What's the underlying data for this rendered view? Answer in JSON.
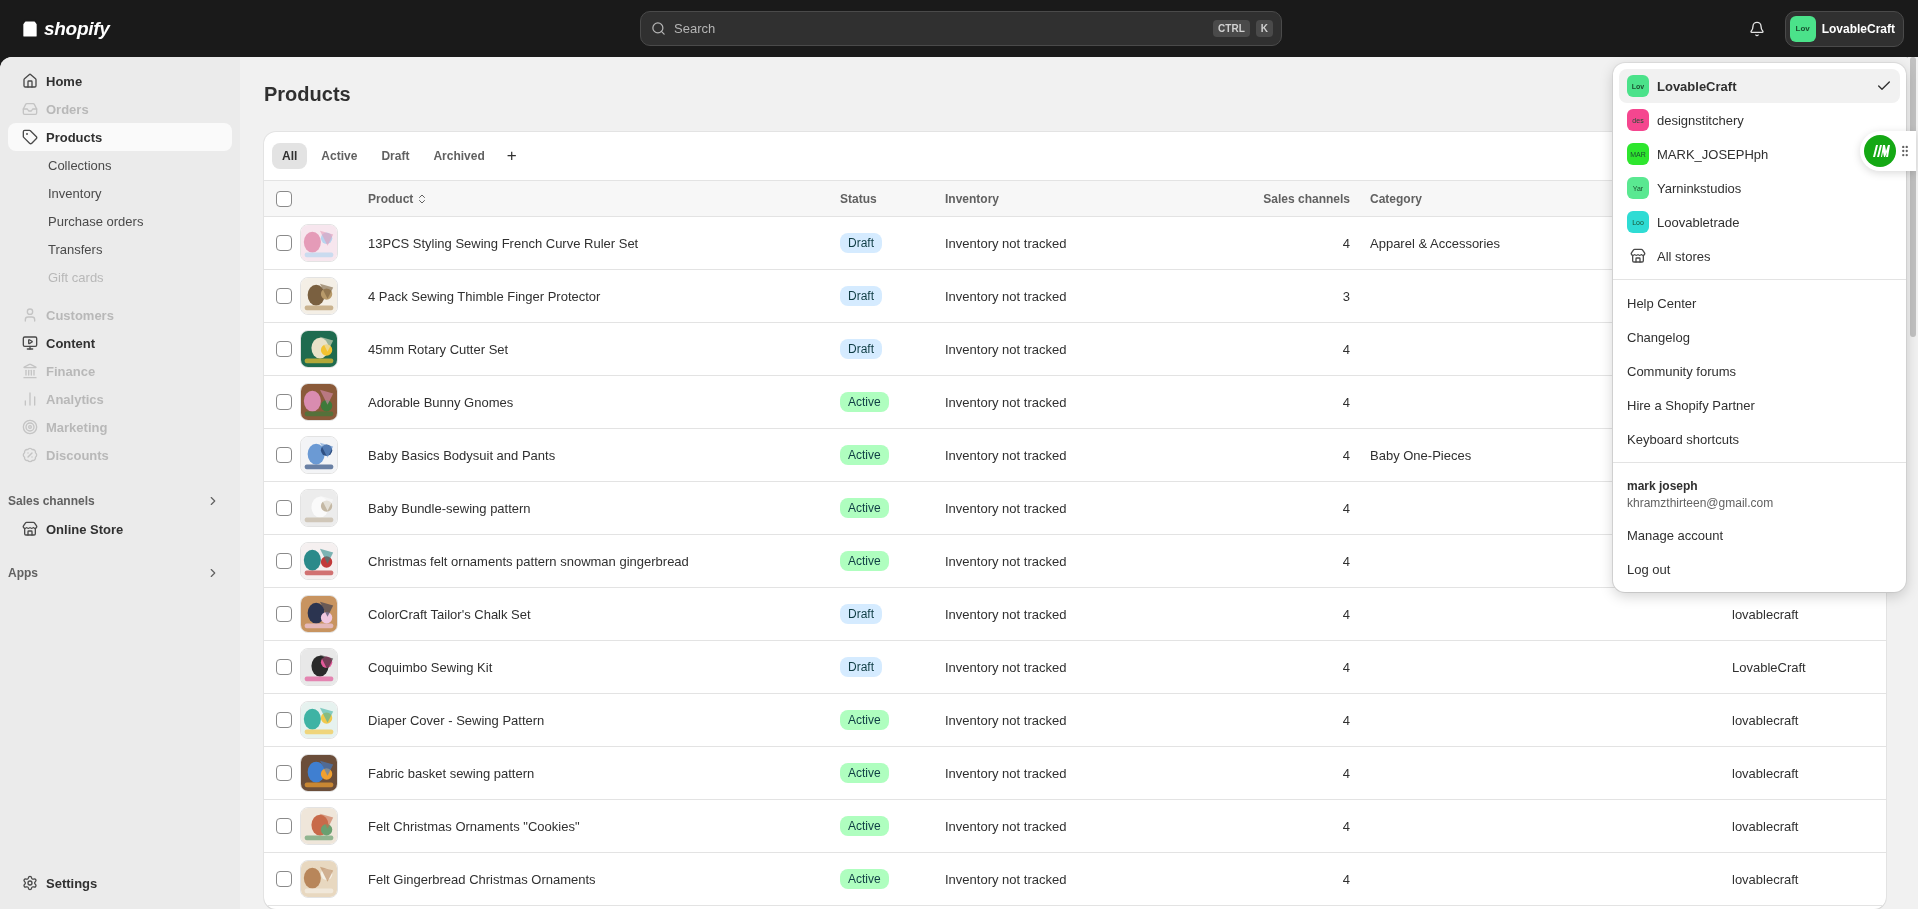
{
  "top_bar": {
    "logo": "shopify",
    "search": {
      "placeholder": "Search",
      "keys": [
        "CTRL",
        "K"
      ]
    },
    "store_button": {
      "initials": "Lov",
      "color": "#4be28a",
      "name": "LovableCraft"
    }
  },
  "sidebar": {
    "items": [
      {
        "label": "Home",
        "disabled": false,
        "selected": false
      },
      {
        "label": "Orders",
        "disabled": true,
        "selected": false
      },
      {
        "label": "Products",
        "disabled": false,
        "selected": true,
        "children": [
          {
            "label": "Collections",
            "disabled": false
          },
          {
            "label": "Inventory",
            "disabled": false
          },
          {
            "label": "Purchase orders",
            "disabled": false
          },
          {
            "label": "Transfers",
            "disabled": false
          },
          {
            "label": "Gift cards",
            "disabled": true
          }
        ]
      },
      {
        "label": "Customers",
        "disabled": true,
        "selected": false
      },
      {
        "label": "Content",
        "disabled": false,
        "selected": false
      },
      {
        "label": "Finance",
        "disabled": true,
        "selected": false
      },
      {
        "label": "Analytics",
        "disabled": true,
        "selected": false
      },
      {
        "label": "Marketing",
        "disabled": true,
        "selected": false
      },
      {
        "label": "Discounts",
        "disabled": true,
        "selected": false
      }
    ],
    "sections": [
      {
        "title": "Sales channels",
        "items": [
          {
            "label": "Online Store"
          }
        ]
      },
      {
        "title": "Apps"
      }
    ],
    "settings": "Settings"
  },
  "page": {
    "title": "Products"
  },
  "tabs": [
    {
      "label": "All",
      "selected": true
    },
    {
      "label": "Active",
      "selected": false
    },
    {
      "label": "Draft",
      "selected": false
    },
    {
      "label": "Archived",
      "selected": false
    }
  ],
  "add_tab": "+",
  "table": {
    "select_all_checked": false,
    "columns": [
      "Product",
      "Status",
      "Inventory",
      "Sales channels",
      "Category"
    ],
    "rows": [
      {
        "checked": false,
        "product": "13PCS Styling Sewing French Curve Ruler Set",
        "status": {
          "label": "Draft",
          "color": "#d5ebff"
        },
        "inventory": "Inventory not tracked",
        "sales_channels": "4",
        "category": "Apparel & Accessories"
      },
      {
        "checked": false,
        "product": "4 Pack Sewing Thimble Finger Protector",
        "status": {
          "label": "Draft",
          "color": "#d5ebff"
        },
        "inventory": "Inventory not tracked",
        "sales_channels": "3"
      },
      {
        "checked": false,
        "product": "45mm Rotary Cutter Set",
        "status": {
          "label": "Draft",
          "color": "#d5ebff"
        },
        "inventory": "Inventory not tracked",
        "sales_channels": "4"
      },
      {
        "checked": false,
        "product": "Adorable Bunny Gnomes",
        "status": {
          "label": "Active",
          "color": "#affebf"
        },
        "inventory": "Inventory not tracked",
        "sales_channels": "4"
      },
      {
        "checked": false,
        "product": "Baby Basics Bodysuit and Pants",
        "status": {
          "label": "Active",
          "color": "#affebf"
        },
        "inventory": "Inventory not tracked",
        "sales_channels": "4",
        "category": "Baby One-Pieces"
      },
      {
        "checked": false,
        "product": "Baby Bundle-sewing pattern",
        "status": {
          "label": "Active",
          "color": "#affebf"
        },
        "inventory": "Inventory not tracked",
        "sales_channels": "4"
      },
      {
        "checked": false,
        "product": "Christmas felt ornaments pattern snowman gingerbread",
        "status": {
          "label": "Active",
          "color": "#affebf"
        },
        "inventory": "Inventory not tracked",
        "sales_channels": "4"
      },
      {
        "checked": false,
        "product": "ColorCraft Tailor's Chalk Set",
        "status": {
          "label": "Draft",
          "color": "#d5ebff"
        },
        "inventory": "Inventory not tracked",
        "sales_channels": "4",
        "column_7": "lovablecraft"
      },
      {
        "checked": false,
        "product": "Coquimbo Sewing Kit",
        "status": {
          "label": "Draft",
          "color": "#d5ebff"
        },
        "inventory": "Inventory not tracked",
        "sales_channels": "4",
        "column_7": "LovableCraft"
      },
      {
        "checked": false,
        "product": "Diaper Cover - Sewing Pattern",
        "status": {
          "label": "Active",
          "color": "#affebf"
        },
        "inventory": "Inventory not tracked",
        "sales_channels": "4",
        "column_7": "lovablecraft"
      },
      {
        "checked": false,
        "product": "Fabric basket sewing pattern",
        "status": {
          "label": "Active",
          "color": "#affebf"
        },
        "inventory": "Inventory not tracked",
        "sales_channels": "4",
        "column_7": "lovablecraft"
      },
      {
        "checked": false,
        "product": "Felt Christmas Ornaments \"Cookies\"",
        "status": {
          "label": "Active",
          "color": "#affebf"
        },
        "inventory": "Inventory not tracked",
        "sales_channels": "4",
        "column_7": "lovablecraft"
      },
      {
        "checked": false,
        "product": "Felt Gingerbread Christmas Ornaments",
        "status": {
          "label": "Active",
          "color": "#affebf"
        },
        "inventory": "Inventory not tracked",
        "sales_channels": "4",
        "column_7": "lovablecraft"
      }
    ]
  },
  "account_menu": {
    "stores": [
      {
        "kind": "store",
        "initials": "Lov",
        "color": "#4be28a",
        "name": "LovableCraft",
        "selected": true
      },
      {
        "kind": "store",
        "initials": "des",
        "color": "#f5468f",
        "name": "designstitchery",
        "selected": false
      },
      {
        "kind": "store",
        "initials": "MAR",
        "color": "#2ee62e",
        "name": "MARK_JOSEPHph",
        "selected": false
      },
      {
        "kind": "store",
        "initials": "Yar",
        "color": "#5ae891",
        "name": "Yarninkstudios",
        "selected": false
      },
      {
        "kind": "store",
        "initials": "Loo",
        "color": "#2fdcd4",
        "name": "Loovabletrade",
        "selected": false
      },
      {
        "kind": "all",
        "name": "All stores",
        "selected": false
      }
    ],
    "links": [
      "Help Center",
      "Changelog",
      "Community forums",
      "Hire a Shopify Partner",
      "Keyboard shortcuts"
    ],
    "user": {
      "name": "mark joseph",
      "email": "khramzthirteen@gmail.com"
    },
    "account_links": [
      "Manage account",
      "Log out"
    ]
  }
}
